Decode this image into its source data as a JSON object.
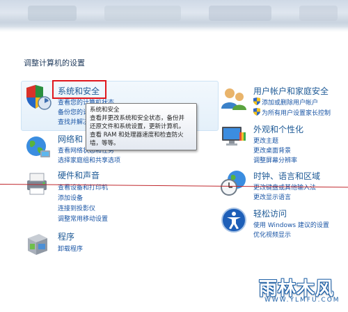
{
  "header": {
    "title": "调整计算机的设置"
  },
  "categories": {
    "system": {
      "title": "系统和安全",
      "links": [
        "查看您的计算机状态",
        "备份您的计算机",
        "查找并解决问题"
      ]
    },
    "network": {
      "title": "网络和 Internet",
      "links": [
        "查看网络状态和任务",
        "选择家庭组和共享选项"
      ]
    },
    "hardware": {
      "title": "硬件和声音",
      "links": [
        "查看设备和打印机",
        "添加设备",
        "连接到投影仪",
        "调整常用移动设置"
      ]
    },
    "programs": {
      "title": "程序",
      "links": [
        "卸载程序"
      ]
    },
    "users": {
      "title": "用户帐户和家庭安全",
      "links": [
        "添加或删除用户帐户",
        "为所有用户设置家长控制"
      ]
    },
    "appearance": {
      "title": "外观和个性化",
      "links": [
        "更改主题",
        "更改桌面背景",
        "调整屏幕分辨率"
      ]
    },
    "clock": {
      "title": "时钟、语言和区域",
      "links": [
        "更改键盘或其他输入法",
        "更改显示语言"
      ]
    },
    "ease": {
      "title": "轻松访问",
      "links": [
        "使用 Windows 建议的设置",
        "优化视频显示"
      ]
    }
  },
  "tooltip": {
    "title": "系统和安全",
    "lines": [
      "查看并更改系统和安全状态，备份并",
      "还原文件和系统设置，更新计算机，",
      "查看 RAM 和处理器速度和检查防火",
      "墙，等等。"
    ]
  },
  "watermark": {
    "main": "雨林木风",
    "sub": "WWW.YLMFU.COM"
  },
  "colors": {
    "link": "#1a55a5",
    "category_title": "#1e5a96",
    "highlight": "#e0161b"
  }
}
